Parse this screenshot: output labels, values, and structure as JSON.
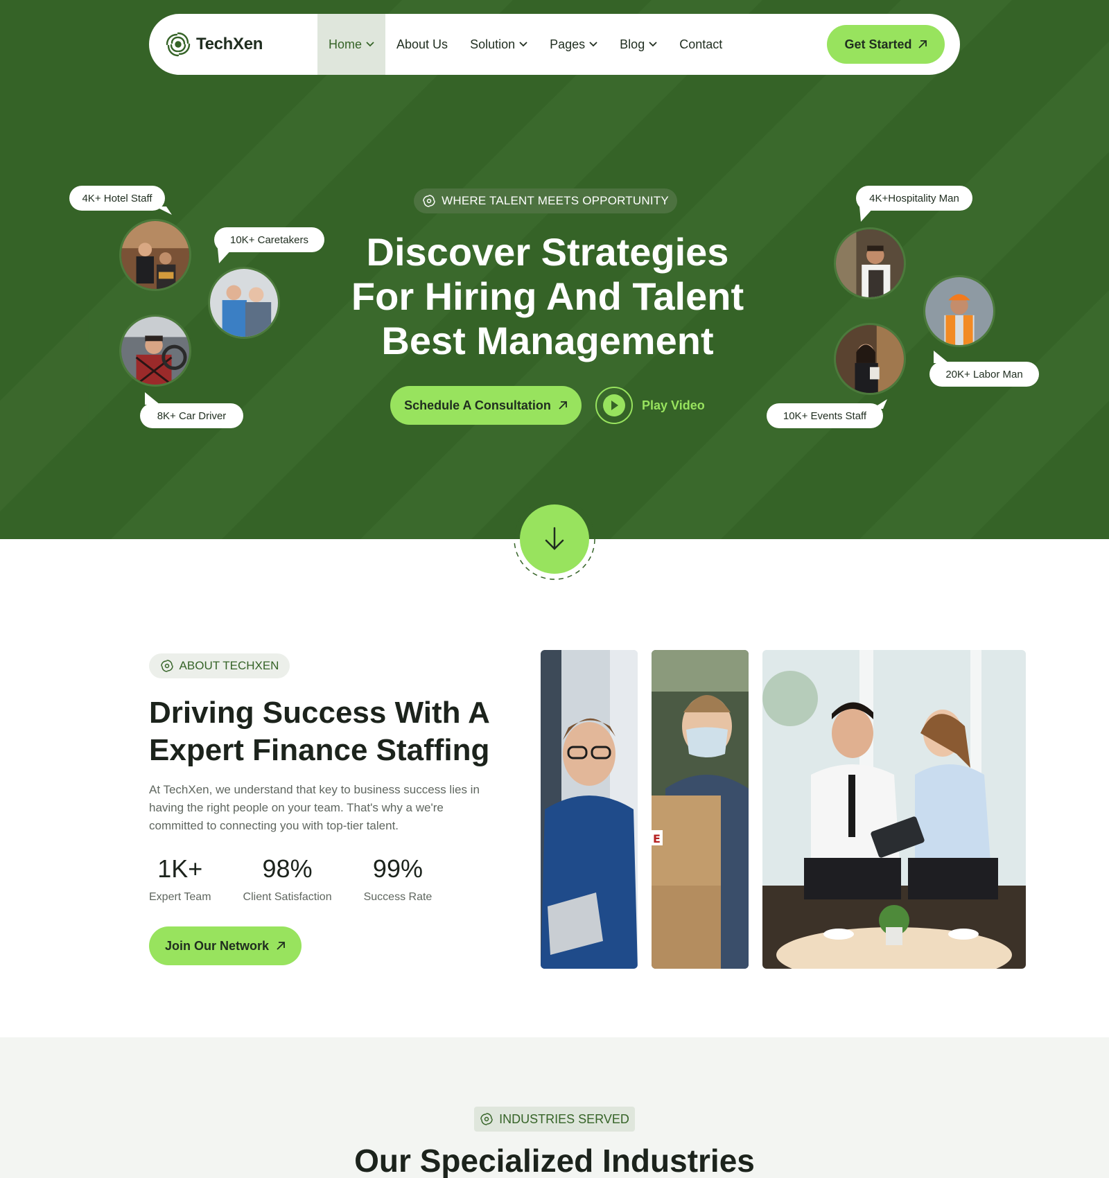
{
  "nav": {
    "logo_text": "TechXen",
    "items": [
      {
        "label": "Home",
        "has_dropdown": true,
        "active": true
      },
      {
        "label": "About Us",
        "has_dropdown": false
      },
      {
        "label": "Solution",
        "has_dropdown": true
      },
      {
        "label": "Pages",
        "has_dropdown": true
      },
      {
        "label": "Blog",
        "has_dropdown": true
      },
      {
        "label": "Contact",
        "has_dropdown": false
      }
    ],
    "cta_label": "Get Started"
  },
  "hero": {
    "tagline": "WHERE TALENT MEETS OPPORTUNITY",
    "title_lines": [
      "Discover Strategies",
      "For Hiring And Talent",
      "Best Management"
    ],
    "primary_button": "Schedule A Consultation",
    "video_button": "Play Video",
    "bubbles": {
      "hotel": "4K+ Hotel Staff",
      "caretakers": "10K+ Caretakers",
      "driver": "8K+ Car Driver",
      "hospitality": "4K+Hospitality Man",
      "labor": "20K+ Labor Man",
      "events": "10K+ Events Staff"
    }
  },
  "about": {
    "pill": "ABOUT TECHXEN",
    "title_lines": [
      "Driving Success With A",
      "Expert Finance Staffing"
    ],
    "text": "At TechXen, we understand that key to business success lies in having the right people on your team. That's why a we're committed to connecting you with top-tier talent.",
    "stats": [
      {
        "value": "1K+",
        "label": "Expert Team"
      },
      {
        "value": "98%",
        "label": "Client Satisfaction"
      },
      {
        "value": "99%",
        "label": "Success Rate"
      }
    ],
    "button": "Join Our Network"
  },
  "industries": {
    "pill": "INDUSTRIES SERVED",
    "title": "Our Specialized Industries"
  },
  "colors": {
    "primary_green": "#356327",
    "accent_lime": "#98e35e",
    "text_dark": "#1c231c"
  }
}
